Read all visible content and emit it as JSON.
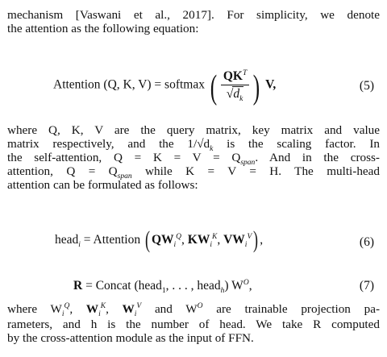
{
  "para1": {
    "line1": "mechanism [Vaswani et al., 2017]. For simplicity, we denote",
    "line2": "the attention as the following equation:"
  },
  "eq5": {
    "lhs": "Attention (Q, K, V) = softmax",
    "numerator": "QK",
    "numerator_sup": "T",
    "denominator": "d",
    "denominator_sub": "k",
    "tail": "V,",
    "number": "(5)"
  },
  "para2": {
    "line1": "where Q, K, V are the query matrix, key matrix and value",
    "line2": "matrix respectively, and the 1/√d",
    "line2b": " is the scaling factor.  In",
    "line3": "the self-attention, Q = K = V = Q",
    "line3b": ". And in the cross-",
    "line4": "attention, Q = Q",
    "line4b": " while K = V = H.  The multi-head",
    "line5": "attention can be formulated as follows:",
    "sub_span": "span",
    "sub_k": "k"
  },
  "eq6": {
    "head": "head",
    "i": "i",
    "equals": "= Attention",
    "qw": "QW",
    "qw_sup": "Q",
    "kw": "KW",
    "kw_sup": "K",
    "vw": "VW",
    "vw_sup": "V",
    "number": "(6)"
  },
  "eq7": {
    "r": "R",
    "equals": "= Concat (head",
    "one": "1",
    "dots": ", . . . , head",
    "h": "h",
    "close": ") W",
    "o_sup": "O",
    "comma": ",",
    "number": "(7)"
  },
  "para3": {
    "line1a": "where W",
    "line1b": " and W",
    "line1c": " are trainable projection pa-",
    "line2": "rameters, and h is the number of head. We take R computed",
    "line3": "by the cross-attention module as the input of FFN.",
    "sep": ", "
  }
}
